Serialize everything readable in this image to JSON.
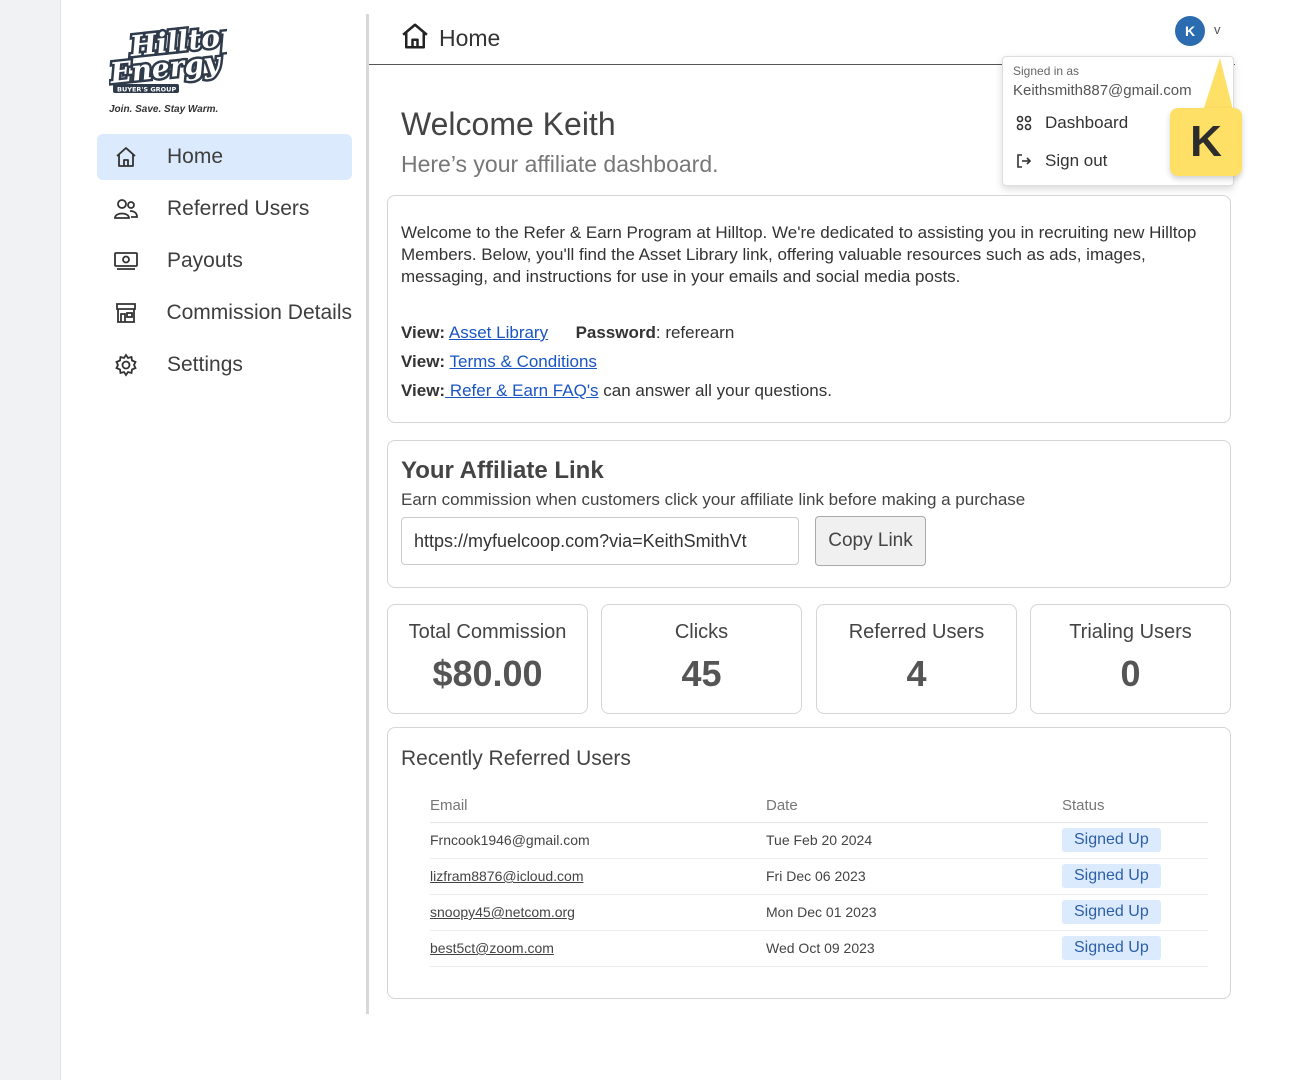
{
  "brand": {
    "logo_name": "hilltop-energy-logo",
    "logo_line1": "Hilltop",
    "logo_line2": "Energy",
    "logo_badge": "BUYER'S GROUP",
    "tagline": "Join. Save. Stay Warm."
  },
  "sidebar": {
    "items": [
      {
        "label": "Home",
        "icon": "home-icon",
        "active": true
      },
      {
        "label": "Referred Users",
        "icon": "users-icon",
        "active": false
      },
      {
        "label": "Payouts",
        "icon": "money-icon",
        "active": false
      },
      {
        "label": "Commission Details",
        "icon": "store-icon",
        "active": false
      },
      {
        "label": "Settings",
        "icon": "gear-icon",
        "active": false
      }
    ]
  },
  "header": {
    "breadcrumb": "Home",
    "avatar_initial": "K",
    "avatar_chevron": "v"
  },
  "user_menu": {
    "signed_in_label": "Signed in as",
    "email": "Keithsmith887@gmail.com",
    "items": [
      {
        "label": "Dashboard",
        "icon": "grid-icon"
      },
      {
        "label": "Sign out",
        "icon": "sign-out-icon"
      }
    ]
  },
  "callout": {
    "key": "K"
  },
  "main": {
    "welcome": "Welcome Keith",
    "subtitle": "Here’s your affiliate dashboard.",
    "intro": {
      "paragraph": "Welcome to the Refer & Earn Program at Hilltop. We're dedicated to assisting you in recruiting new Hilltop Members. Below, you'll find the Asset Library link, offering valuable resources such as ads, images, messaging, and instructions for use in your emails and social media posts.",
      "view_label": "View:",
      "asset_library_link": "Asset Library",
      "password_label": "Password",
      "password_value": ": referearn",
      "terms_link": "Terms & Conditions",
      "faq_link": " Refer & Earn FAQ's",
      "faq_suffix": " can answer all your questions."
    },
    "affiliate": {
      "title": "Your Affiliate Link",
      "description": "Earn commission when customers click your affiliate link before making a purchase",
      "link_value": "https://myfuelcoop.com?via=KeithSmithVt",
      "copy_label": "Copy Link"
    },
    "stats": [
      {
        "label": "Total Commission",
        "value": "$80.00"
      },
      {
        "label": "Clicks",
        "value": "45"
      },
      {
        "label": "Referred Users",
        "value": "4"
      },
      {
        "label": "Trialing Users",
        "value": "0"
      }
    ],
    "recent": {
      "title": "Recently Referred Users",
      "columns": [
        "Email",
        "Date",
        "Status"
      ],
      "rows": [
        {
          "email": "Frncook1946@gmail.com",
          "date": "Tue Feb 20 2024",
          "status": "Signed Up"
        },
        {
          "email": "lizfram8876@icloud.com",
          "date": "Fri Dec 06 2023",
          "status": "Signed Up"
        },
        {
          "email": "snoopy45@netcom.org",
          "date": "Mon Dec 01 2023",
          "status": "Signed Up"
        },
        {
          "email": "best5ct@zoom.com",
          "date": "Wed Oct 09 2023",
          "status": "Signed Up"
        }
      ]
    }
  },
  "colors": {
    "accent": "#2b6cb0",
    "active_nav_bg": "#dbeafc",
    "link": "#1a55c4",
    "callout_bg": "#ffe066"
  }
}
